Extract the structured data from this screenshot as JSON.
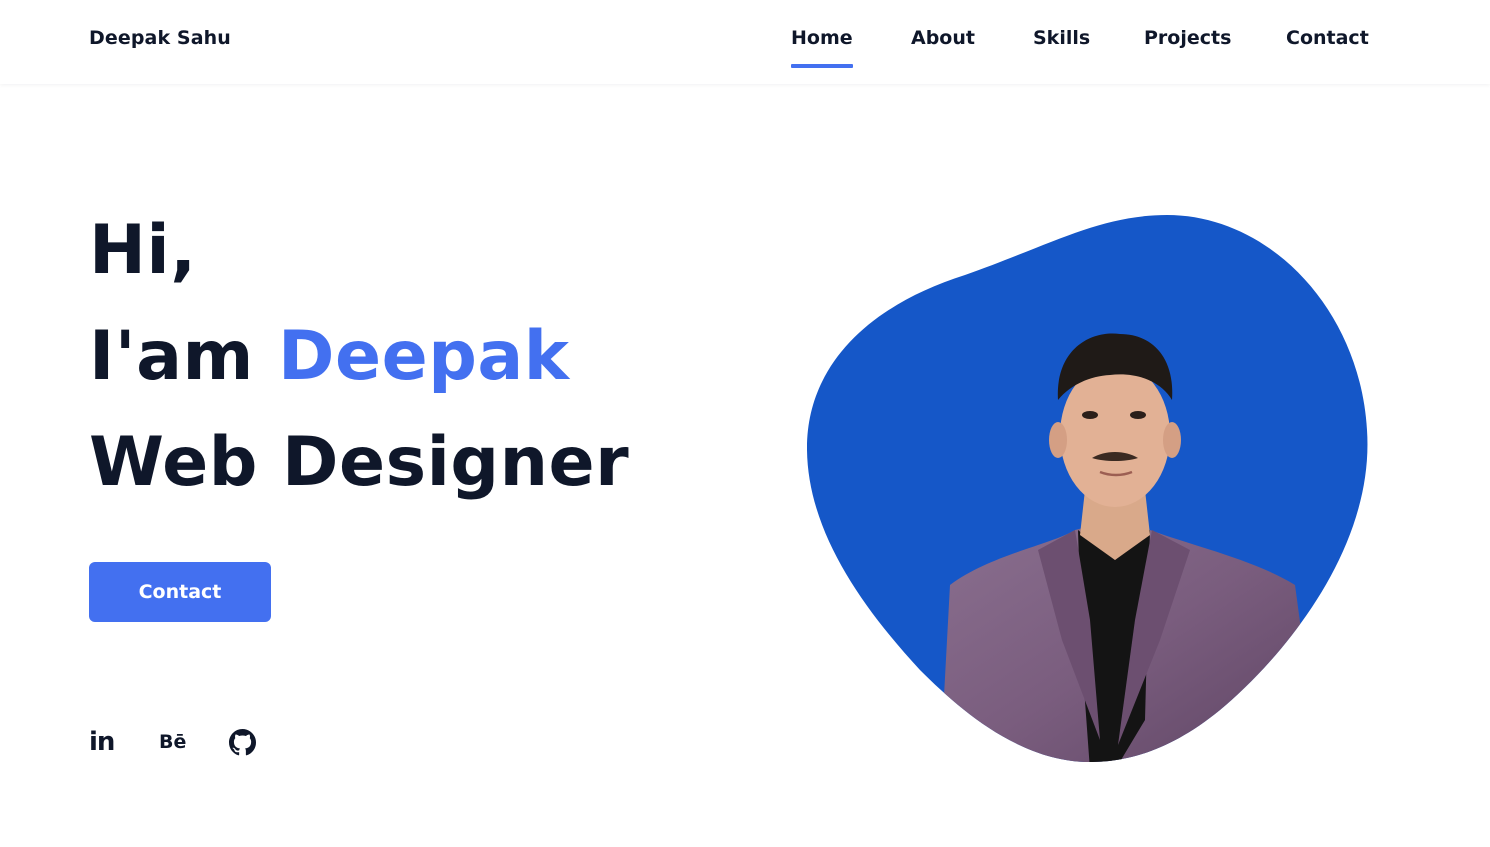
{
  "header": {
    "brand": "Deepak Sahu",
    "nav": [
      {
        "label": "Home",
        "active": true
      },
      {
        "label": "About",
        "active": false
      },
      {
        "label": "Skills",
        "active": false
      },
      {
        "label": "Projects",
        "active": false
      },
      {
        "label": "Contact",
        "active": false
      }
    ]
  },
  "hero": {
    "greeting": "Hi,",
    "intro": "I'am ",
    "name": "Deepak",
    "role": "Web Designer",
    "button_label": "Contact"
  },
  "social": {
    "linkedin_label": "in",
    "behance_label": "Bē",
    "github_icon": "github-icon"
  },
  "colors": {
    "accent": "#4370f0",
    "blob": "#1557c8",
    "text": "#0f172a"
  }
}
